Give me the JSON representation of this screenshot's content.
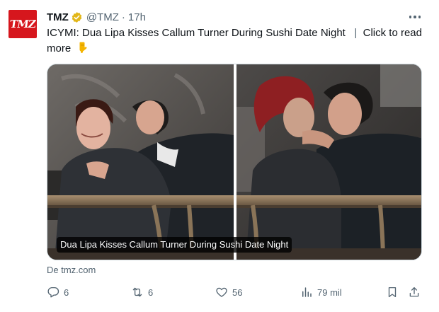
{
  "account": {
    "avatar_text": "TMZ",
    "name": "TMZ",
    "handle": "@TMZ",
    "separator": "·",
    "time": "17h",
    "brand_color": "#d6161d",
    "verified_badge_color": "#e2b719"
  },
  "tweet": {
    "text_main": "ICYMI: Dua Lipa Kisses Callum Turner During Sushi Date Night",
    "text_sep": "|",
    "text_link": "Click to read more",
    "emoji": "backhand-index-pointing-down"
  },
  "media": {
    "caption": "Dua Lipa Kisses Callum Turner During Sushi Date Night"
  },
  "source": "De tmz.com",
  "actions": {
    "replies": "6",
    "reposts": "6",
    "likes": "56",
    "views": "79 mil"
  },
  "icons": {
    "reply": "reply-icon",
    "repost": "repost-icon",
    "like": "heart-icon",
    "views": "analytics-icon",
    "bookmark": "bookmark-icon",
    "share": "share-icon",
    "more": "more-icon"
  }
}
